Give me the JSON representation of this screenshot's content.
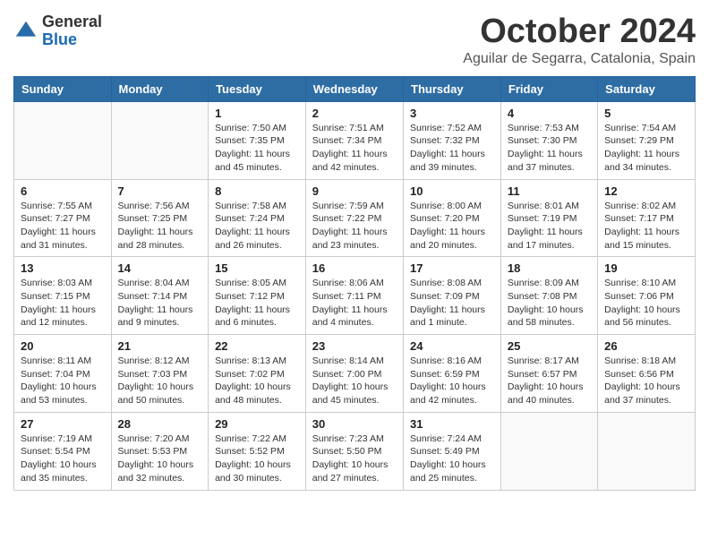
{
  "header": {
    "logo_line1": "General",
    "logo_line2": "Blue",
    "month": "October 2024",
    "location": "Aguilar de Segarra, Catalonia, Spain"
  },
  "days_of_week": [
    "Sunday",
    "Monday",
    "Tuesday",
    "Wednesday",
    "Thursday",
    "Friday",
    "Saturday"
  ],
  "weeks": [
    [
      {
        "day": "",
        "info": ""
      },
      {
        "day": "",
        "info": ""
      },
      {
        "day": "1",
        "info": "Sunrise: 7:50 AM\nSunset: 7:35 PM\nDaylight: 11 hours and 45 minutes."
      },
      {
        "day": "2",
        "info": "Sunrise: 7:51 AM\nSunset: 7:34 PM\nDaylight: 11 hours and 42 minutes."
      },
      {
        "day": "3",
        "info": "Sunrise: 7:52 AM\nSunset: 7:32 PM\nDaylight: 11 hours and 39 minutes."
      },
      {
        "day": "4",
        "info": "Sunrise: 7:53 AM\nSunset: 7:30 PM\nDaylight: 11 hours and 37 minutes."
      },
      {
        "day": "5",
        "info": "Sunrise: 7:54 AM\nSunset: 7:29 PM\nDaylight: 11 hours and 34 minutes."
      }
    ],
    [
      {
        "day": "6",
        "info": "Sunrise: 7:55 AM\nSunset: 7:27 PM\nDaylight: 11 hours and 31 minutes."
      },
      {
        "day": "7",
        "info": "Sunrise: 7:56 AM\nSunset: 7:25 PM\nDaylight: 11 hours and 28 minutes."
      },
      {
        "day": "8",
        "info": "Sunrise: 7:58 AM\nSunset: 7:24 PM\nDaylight: 11 hours and 26 minutes."
      },
      {
        "day": "9",
        "info": "Sunrise: 7:59 AM\nSunset: 7:22 PM\nDaylight: 11 hours and 23 minutes."
      },
      {
        "day": "10",
        "info": "Sunrise: 8:00 AM\nSunset: 7:20 PM\nDaylight: 11 hours and 20 minutes."
      },
      {
        "day": "11",
        "info": "Sunrise: 8:01 AM\nSunset: 7:19 PM\nDaylight: 11 hours and 17 minutes."
      },
      {
        "day": "12",
        "info": "Sunrise: 8:02 AM\nSunset: 7:17 PM\nDaylight: 11 hours and 15 minutes."
      }
    ],
    [
      {
        "day": "13",
        "info": "Sunrise: 8:03 AM\nSunset: 7:15 PM\nDaylight: 11 hours and 12 minutes."
      },
      {
        "day": "14",
        "info": "Sunrise: 8:04 AM\nSunset: 7:14 PM\nDaylight: 11 hours and 9 minutes."
      },
      {
        "day": "15",
        "info": "Sunrise: 8:05 AM\nSunset: 7:12 PM\nDaylight: 11 hours and 6 minutes."
      },
      {
        "day": "16",
        "info": "Sunrise: 8:06 AM\nSunset: 7:11 PM\nDaylight: 11 hours and 4 minutes."
      },
      {
        "day": "17",
        "info": "Sunrise: 8:08 AM\nSunset: 7:09 PM\nDaylight: 11 hours and 1 minute."
      },
      {
        "day": "18",
        "info": "Sunrise: 8:09 AM\nSunset: 7:08 PM\nDaylight: 10 hours and 58 minutes."
      },
      {
        "day": "19",
        "info": "Sunrise: 8:10 AM\nSunset: 7:06 PM\nDaylight: 10 hours and 56 minutes."
      }
    ],
    [
      {
        "day": "20",
        "info": "Sunrise: 8:11 AM\nSunset: 7:04 PM\nDaylight: 10 hours and 53 minutes."
      },
      {
        "day": "21",
        "info": "Sunrise: 8:12 AM\nSunset: 7:03 PM\nDaylight: 10 hours and 50 minutes."
      },
      {
        "day": "22",
        "info": "Sunrise: 8:13 AM\nSunset: 7:02 PM\nDaylight: 10 hours and 48 minutes."
      },
      {
        "day": "23",
        "info": "Sunrise: 8:14 AM\nSunset: 7:00 PM\nDaylight: 10 hours and 45 minutes."
      },
      {
        "day": "24",
        "info": "Sunrise: 8:16 AM\nSunset: 6:59 PM\nDaylight: 10 hours and 42 minutes."
      },
      {
        "day": "25",
        "info": "Sunrise: 8:17 AM\nSunset: 6:57 PM\nDaylight: 10 hours and 40 minutes."
      },
      {
        "day": "26",
        "info": "Sunrise: 8:18 AM\nSunset: 6:56 PM\nDaylight: 10 hours and 37 minutes."
      }
    ],
    [
      {
        "day": "27",
        "info": "Sunrise: 7:19 AM\nSunset: 5:54 PM\nDaylight: 10 hours and 35 minutes."
      },
      {
        "day": "28",
        "info": "Sunrise: 7:20 AM\nSunset: 5:53 PM\nDaylight: 10 hours and 32 minutes."
      },
      {
        "day": "29",
        "info": "Sunrise: 7:22 AM\nSunset: 5:52 PM\nDaylight: 10 hours and 30 minutes."
      },
      {
        "day": "30",
        "info": "Sunrise: 7:23 AM\nSunset: 5:50 PM\nDaylight: 10 hours and 27 minutes."
      },
      {
        "day": "31",
        "info": "Sunrise: 7:24 AM\nSunset: 5:49 PM\nDaylight: 10 hours and 25 minutes."
      },
      {
        "day": "",
        "info": ""
      },
      {
        "day": "",
        "info": ""
      }
    ]
  ]
}
